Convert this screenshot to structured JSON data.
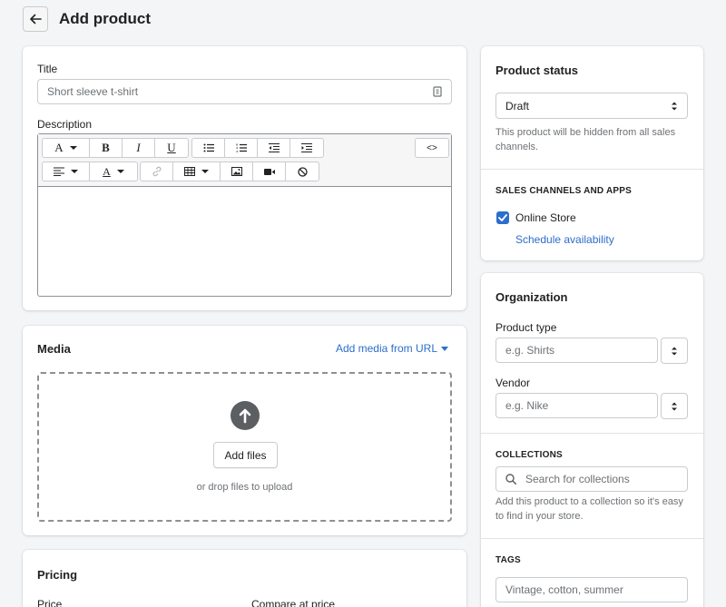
{
  "header": {
    "title": "Add product",
    "back_icon": "arrow-left-icon"
  },
  "product_card": {
    "title_label": "Title",
    "title_placeholder": "Short sleeve t-shirt",
    "description_label": "Description",
    "toolbar": {
      "font": "A",
      "bold": "B",
      "italic": "I",
      "underline": "U",
      "code": "<>",
      "text_color": "A"
    }
  },
  "media": {
    "heading": "Media",
    "add_from_url": "Add media from URL",
    "add_files": "Add files",
    "drop_text": "or drop files to upload"
  },
  "pricing": {
    "heading": "Pricing",
    "price_label": "Price",
    "compare_label": "Compare at price"
  },
  "status": {
    "heading": "Product status",
    "selected": "Draft",
    "help": "This product will be hidden from all sales channels.",
    "channels_heading": "SALES CHANNELS AND APPS",
    "channel_online_store": "Online Store",
    "channel_checked": true,
    "schedule_link": "Schedule availability"
  },
  "organization": {
    "heading": "Organization",
    "product_type_label": "Product type",
    "product_type_placeholder": "e.g. Shirts",
    "vendor_label": "Vendor",
    "vendor_placeholder": "e.g. Nike",
    "collections_heading": "COLLECTIONS",
    "collections_placeholder": "Search for collections",
    "collections_help": "Add this product to a collection so it's easy to find in your store.",
    "tags_heading": "TAGS",
    "tags_placeholder": "Vintage, cotton, summer"
  },
  "colors": {
    "link": "#2c6ecb",
    "upload_circle": "#5c5f62",
    "checkbox": "#2c6ecb"
  }
}
